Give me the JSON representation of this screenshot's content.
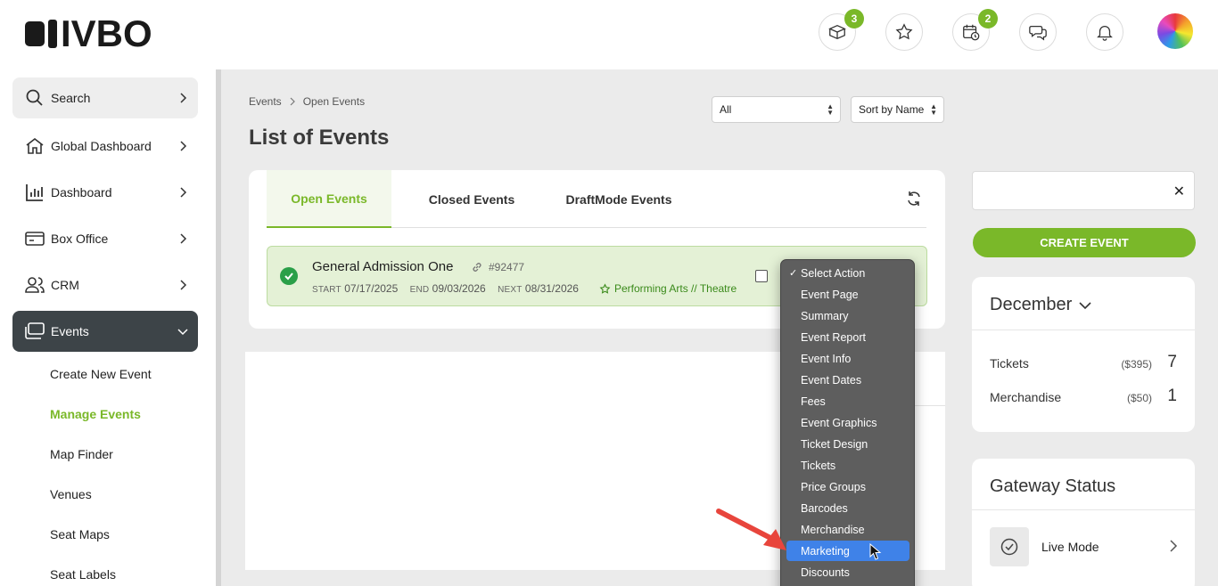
{
  "brand": {
    "logo_text": "IVBO",
    "accent": "#7ab829"
  },
  "header": {
    "icons": [
      {
        "name": "packages-icon",
        "badge": "3"
      },
      {
        "name": "star-icon",
        "badge": ""
      },
      {
        "name": "calendar-clock-icon",
        "badge": "2"
      },
      {
        "name": "chat-icon",
        "badge": ""
      },
      {
        "name": "bell-icon",
        "badge": ""
      }
    ]
  },
  "sidebar": {
    "items": [
      {
        "label": "Search",
        "icon": "search-icon"
      },
      {
        "label": "Global Dashboard",
        "icon": "home-icon"
      },
      {
        "label": "Dashboard",
        "icon": "bar-chart-icon"
      },
      {
        "label": "Box Office",
        "icon": "box-office-icon"
      },
      {
        "label": "CRM",
        "icon": "users-icon"
      },
      {
        "label": "Events",
        "icon": "tickets-icon",
        "active": true
      }
    ],
    "sub_items": [
      "Create New Event",
      "Manage Events",
      "Map Finder",
      "Venues",
      "Seat Maps",
      "Seat Labels"
    ],
    "active_sub": "Manage Events"
  },
  "breadcrumb": {
    "root": "Events",
    "current": "Open Events"
  },
  "page_title": "List of Events",
  "filters": {
    "status": "All",
    "sort": "Sort by Name"
  },
  "tabs": [
    "Open Events",
    "Closed Events",
    "DraftMode Events"
  ],
  "active_tab": "Open Events",
  "event": {
    "name": "General Admission One",
    "id": "#92477",
    "start_caption": "START",
    "start": "07/17/2025",
    "end_caption": "END",
    "end": "09/03/2026",
    "next_caption": "NEXT",
    "next": "08/31/2026",
    "category": "Performing Arts // Theatre"
  },
  "action_menu": {
    "items": [
      "Select Action",
      "Event Page",
      "Summary",
      "Event Report",
      "Event Info",
      "Event Dates",
      "Fees",
      "Event Graphics",
      "Ticket Design",
      "Tickets",
      "Price Groups",
      "Barcodes",
      "Merchandise",
      "Marketing",
      "Discounts"
    ],
    "selected": "Select Action",
    "highlighted": "Marketing"
  },
  "right_panel": {
    "search_placeholder": "",
    "create_button": "CREATE EVENT",
    "month": "December",
    "stats": [
      {
        "label": "Tickets",
        "amount": "($395)",
        "count": "7"
      },
      {
        "label": "Merchandise",
        "amount": "($50)",
        "count": "1"
      }
    ],
    "gateway_title": "Gateway Status",
    "gateway_mode": "Live Mode"
  }
}
